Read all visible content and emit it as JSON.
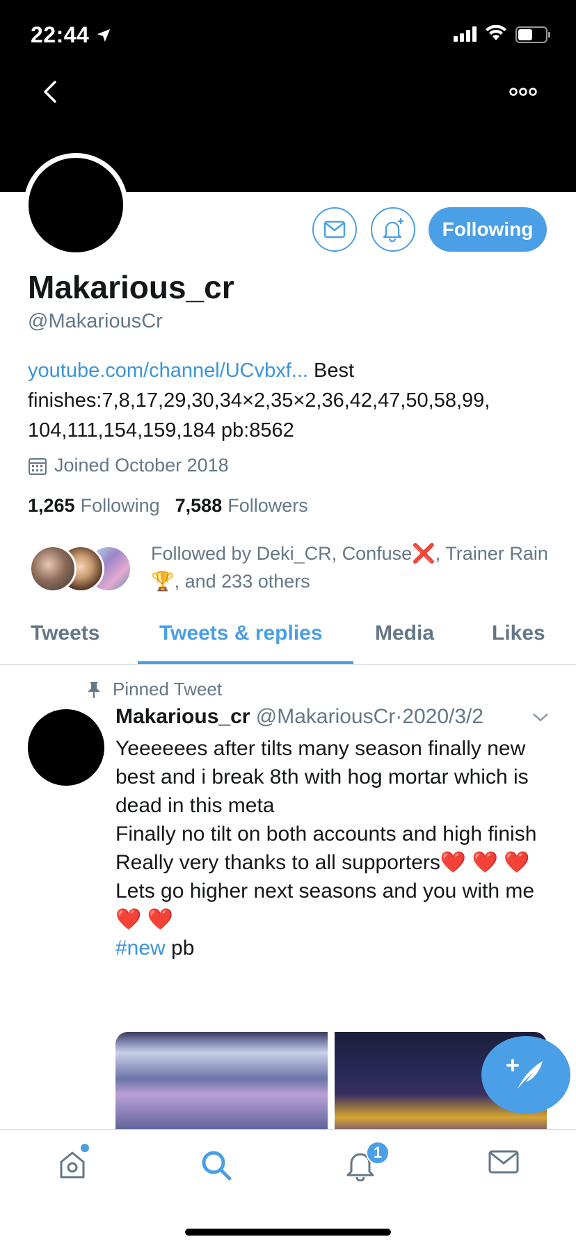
{
  "status_bar": {
    "time": "22:44"
  },
  "profile": {
    "display_name": "Makarious_cr",
    "handle": "@MakariousCr",
    "bio_link": "youtube.com/channel/UCvbxf...",
    "bio_text": " Best finishes:7,8,17,29,30,34×2,35×2,36,42,47,50,58,99, 104,111,154,159,184 pb:8562",
    "joined": "Joined October 2018",
    "following_count": "1,265",
    "following_label": "Following",
    "followers_count": "7,588",
    "followers_label": "Followers",
    "followed_by": "Followed by Deki_CR, Confuse❌, Trainer Rain 🏆, and 233 others",
    "follow_button_label": "Following"
  },
  "tabs": [
    {
      "label": "Tweets"
    },
    {
      "label": "Tweets & replies"
    },
    {
      "label": "Media"
    },
    {
      "label": "Likes"
    }
  ],
  "active_tab": "Tweets & replies",
  "tweet": {
    "pinned_label": "Pinned Tweet",
    "name": "Makarious_cr",
    "handle": "@MakariousCr",
    "separator": "·",
    "date": "2020/3/2",
    "lines": [
      "Yeeeeees after tilts many season finally new best and i break 8th with hog mortar which is dead in this meta",
      "Finally no tilt on both accounts and high finish",
      "Really very thanks to all supporters❤️ ❤️ ❤️",
      "Lets go higher next seasons and you with me❤️ ❤️"
    ],
    "hashtag": "#new",
    "after_hashtag": " pb"
  },
  "bottom_nav": {
    "notification_badge": "1"
  },
  "colors": {
    "accent": "#4a9fe6",
    "link": "#3b94d9",
    "secondary_text": "#657786",
    "header": "#000000"
  },
  "icons": [
    "location-arrow-icon",
    "signal-icon",
    "wifi-icon",
    "battery-icon",
    "back-chevron-icon",
    "more-icon",
    "mail-icon",
    "bell-plus-icon",
    "calendar-icon",
    "pin-icon",
    "chevron-down-icon",
    "compose-icon",
    "home-icon",
    "search-icon",
    "bell-icon",
    "mail-icon"
  ]
}
